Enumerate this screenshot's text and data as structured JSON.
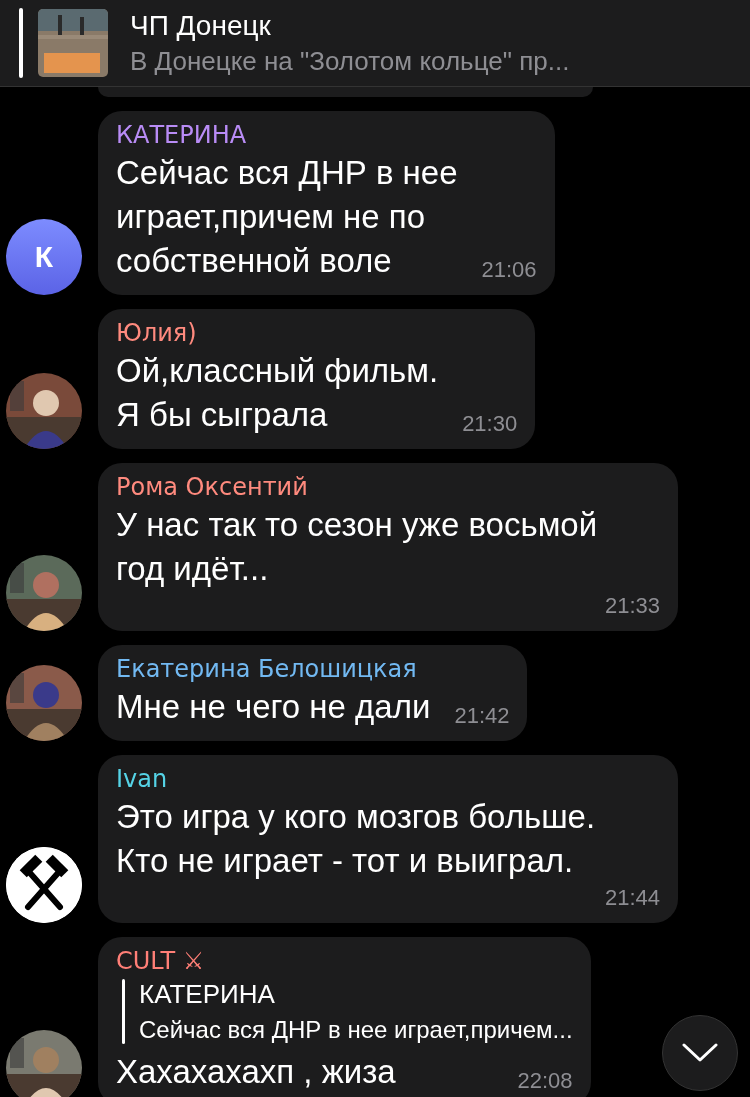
{
  "pinned": {
    "title": "ЧП Донецк",
    "text": "В Донецке на \"Золотом кольце\" пр..."
  },
  "messages": [
    {
      "author": "КАТЕРИНА",
      "color": "#b98cf6",
      "avatar": {
        "kind": "letter",
        "letter": "К"
      },
      "text": "Сейчас вся ДНР в нее\nиграет,причем не по\nсобственной воле",
      "time": "21:06"
    },
    {
      "author": "Юлия)",
      "color": "#ff8a7e",
      "text": "Ой,классный фильм.\nЯ бы сыграла",
      "time": "21:30"
    },
    {
      "author": "Рома Оксентий",
      "color": "#ff8a7e",
      "text": "У нас так то сезон уже восьмой\nгод идёт...",
      "time": "21:33"
    },
    {
      "author": "Екатерина Белошицкая",
      "color": "#72b9f2",
      "text": "Мне не чего не дали",
      "time": "21:42"
    },
    {
      "author": "Ivan",
      "color": "#55d3e6",
      "avatar": {
        "kind": "emblem"
      },
      "text": "Это игра у кого мозгов больше.\nКто не играет - тот и выиграл.",
      "time": "21:44"
    },
    {
      "author": "CULT ⚔",
      "color": "#ff7f77",
      "reply": {
        "author": "КАТЕРИНА",
        "text": "Сейчас вся ДНР в нее играет,причем..."
      },
      "text": "Хахахахахп , жиза",
      "time": "22:08"
    }
  ]
}
